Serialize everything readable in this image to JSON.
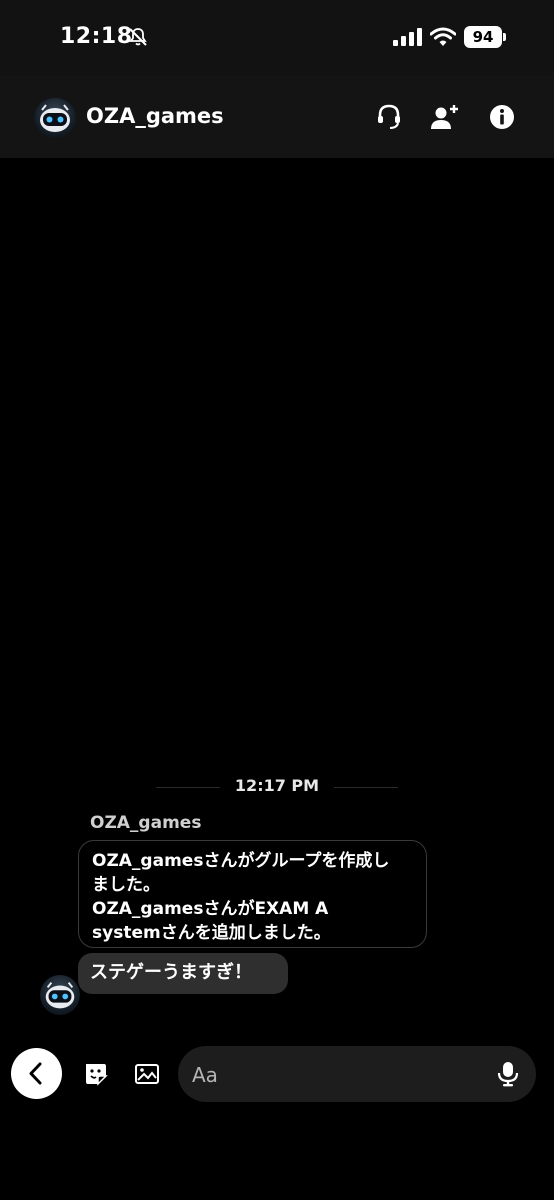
{
  "status_bar": {
    "time": "12:18",
    "battery": "94"
  },
  "header": {
    "title": "OZA_games"
  },
  "chat": {
    "timestamp": "12:17 PM",
    "sender": "OZA_games",
    "system_message_lines": [
      "OZA_gamesさんがグループを作成し",
      "ました。",
      "OZA_gamesさんがEXAM A",
      "systemさんを追加しました。"
    ],
    "message": "ステゲーうますぎ！"
  },
  "composer": {
    "placeholder": "Aa"
  },
  "icons": {
    "mute": "bell-slash-icon",
    "signal": "cellular-signal-icon",
    "wifi": "wifi-icon",
    "call": "headset-icon",
    "add_member": "add-person-icon",
    "info": "info-icon",
    "back": "chevron-left-icon",
    "sticker": "sticker-icon",
    "image": "image-icon",
    "mic": "microphone-icon"
  },
  "colors": {
    "background": "#000000",
    "header": "#141414",
    "bubble": "#2f2f2f",
    "composer": "#1d1d1d"
  }
}
